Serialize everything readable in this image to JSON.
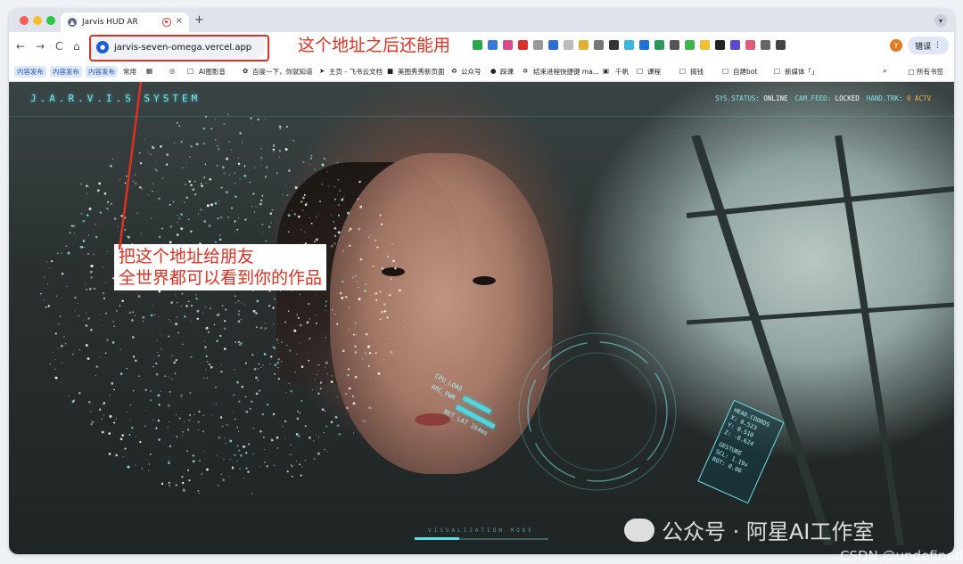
{
  "browser": {
    "tab_title": "Jarvis HUD AR",
    "tab_close": "×",
    "new_tab": "+",
    "url": "jarvis-seven-omega.vercel.app",
    "profile_initial": "Y",
    "error_button": "错误",
    "nav": {
      "back": "←",
      "forward": "→",
      "reload": "C",
      "home": "⌂"
    }
  },
  "annotations": {
    "url_note": "这个地址之后还能用",
    "share_note_line1": "把这个地址给朋友",
    "share_note_line2": "全世界都可以看到你的作品"
  },
  "bookmarks": {
    "items": [
      "内容发布",
      "内容发布",
      "内容发布",
      "常用",
      "AI图影音",
      "百度一下，你就知道",
      "主页 - 飞书云文档",
      "美图秀秀新页面",
      "公众号",
      "踩课",
      "结束进程快捷键 ma...",
      "千帆",
      "课程",
      "搞钱",
      "自建bot",
      "新媒体「」"
    ],
    "overflow": "»",
    "all_bookmarks": "所有书签"
  },
  "hud": {
    "system_title": "J.A.R.V.I.S SYSTEM",
    "status": [
      {
        "label": "SYS.STATUS:",
        "value": "ONLINE"
      },
      {
        "label": "CAM.FEED:",
        "value": "LOCKED"
      },
      {
        "label": "HAND.TRK:",
        "value": "0 ACTV"
      }
    ],
    "arc_labels": {
      "cpu": "CPU_LOAD",
      "arc": "ARC_PWR",
      "net": "NET_LAT 164ms"
    },
    "head_coords": {
      "title": "HEAD.COORDS",
      "x": "X: 0.523",
      "y": "Y: 0.510",
      "z": "Z: -0.624",
      "gesture_title": "GESTURE",
      "scl": "SCL: 1.19x",
      "rot": "ROT: 0.00"
    },
    "mode_label": "VISUALIZATION MODE",
    "colors": {
      "accent": "#7fe3ea",
      "warn": "#f0b040",
      "annotation_red": "#e03020"
    }
  },
  "watermark": {
    "text": "公众号 · 阿星AI工作室",
    "csdn": "CSDN @undefined"
  }
}
